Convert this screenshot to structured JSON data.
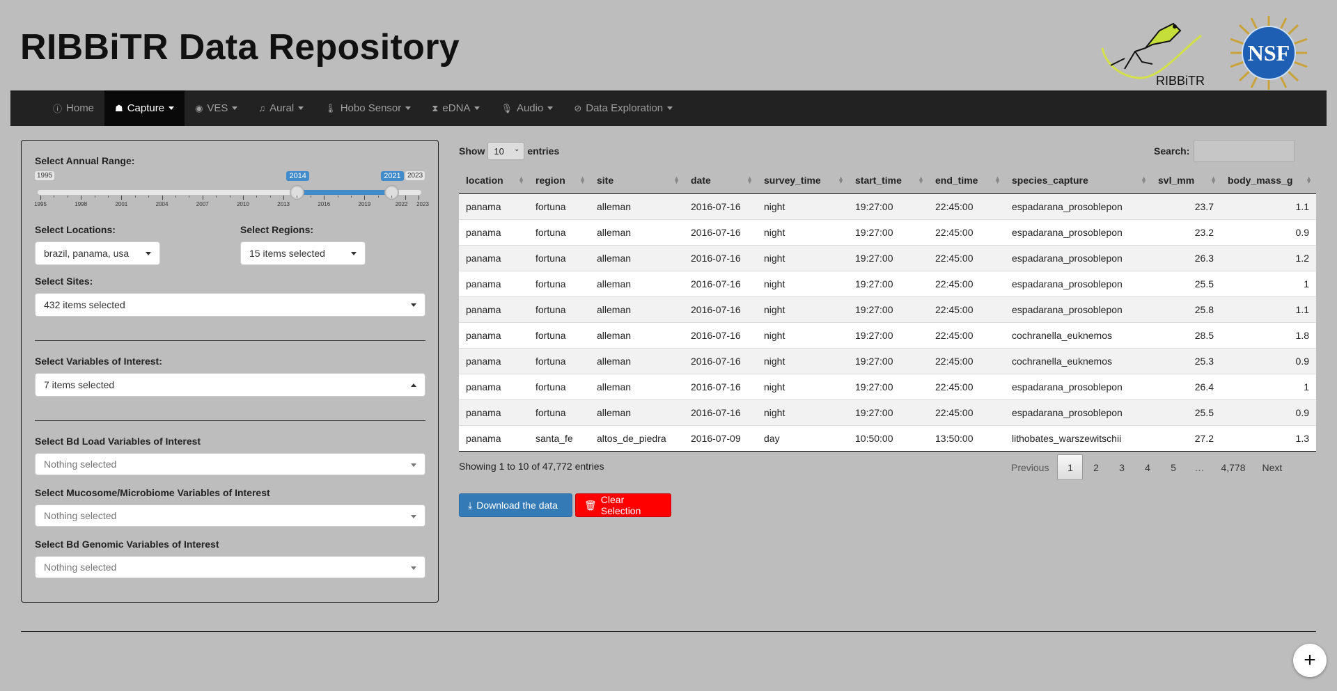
{
  "header": {
    "title": "RIBBiTR Data Repository",
    "ribbitr_logo_text": "RIBBiTR",
    "nsf_logo_text": "NSF"
  },
  "nav": {
    "items": [
      {
        "label": "Home",
        "icon": "info-circle-icon",
        "dropdown": false,
        "active": false
      },
      {
        "label": "Capture",
        "icon": "frog-icon",
        "dropdown": true,
        "active": true
      },
      {
        "label": "VES",
        "icon": "eye-icon",
        "dropdown": true,
        "active": false
      },
      {
        "label": "Aural",
        "icon": "music-icon",
        "dropdown": true,
        "active": false
      },
      {
        "label": "Hobo Sensor",
        "icon": "thermometer-icon",
        "dropdown": true,
        "active": false
      },
      {
        "label": "eDNA",
        "icon": "hourglass-icon",
        "dropdown": true,
        "active": false
      },
      {
        "label": "Audio",
        "icon": "microphone-icon",
        "dropdown": true,
        "active": false
      },
      {
        "label": "Data Exploration",
        "icon": "compass-icon",
        "dropdown": true,
        "active": false
      }
    ]
  },
  "sidebar": {
    "annual_range": {
      "label": "Select Annual Range:",
      "min": 1995,
      "max": 2023,
      "from": 2014,
      "to": 2021,
      "min_label": "1995",
      "max_label": "2023",
      "from_label": "2014",
      "to_label": "2021",
      "tick_labels": [
        "1995",
        "1998",
        "2001",
        "2004",
        "2007",
        "2010",
        "2013",
        "2016",
        "2019",
        "2022",
        "2023"
      ]
    },
    "locations": {
      "label": "Select Locations:",
      "value": "brazil, panama, usa"
    },
    "regions": {
      "label": "Select Regions:",
      "value": "15 items selected"
    },
    "sites": {
      "label": "Select Sites:",
      "value": "432 items selected"
    },
    "variables": {
      "label": "Select Variables of Interest:",
      "value": "7 items selected"
    },
    "bd_load": {
      "label": "Select Bd Load Variables of Interest",
      "value": "Nothing selected"
    },
    "mucosome": {
      "label": "Select Mucosome/Microbiome Variables of Interest",
      "value": "Nothing selected"
    },
    "bd_genomic": {
      "label": "Select Bd Genomic Variables of Interest",
      "value": "Nothing selected"
    }
  },
  "table": {
    "show_label": "Show",
    "entries_label": "entries",
    "page_length": "10",
    "search_label": "Search:",
    "columns": [
      "location",
      "region",
      "site",
      "date",
      "survey_time",
      "start_time",
      "end_time",
      "species_capture",
      "svl_mm",
      "body_mass_g"
    ],
    "rows": [
      [
        "panama",
        "fortuna",
        "alleman",
        "2016-07-16",
        "night",
        "19:27:00",
        "22:45:00",
        "espadarana_prosoblepon",
        "23.7",
        "1.1"
      ],
      [
        "panama",
        "fortuna",
        "alleman",
        "2016-07-16",
        "night",
        "19:27:00",
        "22:45:00",
        "espadarana_prosoblepon",
        "23.2",
        "0.9"
      ],
      [
        "panama",
        "fortuna",
        "alleman",
        "2016-07-16",
        "night",
        "19:27:00",
        "22:45:00",
        "espadarana_prosoblepon",
        "26.3",
        "1.2"
      ],
      [
        "panama",
        "fortuna",
        "alleman",
        "2016-07-16",
        "night",
        "19:27:00",
        "22:45:00",
        "espadarana_prosoblepon",
        "25.5",
        "1"
      ],
      [
        "panama",
        "fortuna",
        "alleman",
        "2016-07-16",
        "night",
        "19:27:00",
        "22:45:00",
        "espadarana_prosoblepon",
        "25.8",
        "1.1"
      ],
      [
        "panama",
        "fortuna",
        "alleman",
        "2016-07-16",
        "night",
        "19:27:00",
        "22:45:00",
        "cochranella_euknemos",
        "28.5",
        "1.8"
      ],
      [
        "panama",
        "fortuna",
        "alleman",
        "2016-07-16",
        "night",
        "19:27:00",
        "22:45:00",
        "cochranella_euknemos",
        "25.3",
        "0.9"
      ],
      [
        "panama",
        "fortuna",
        "alleman",
        "2016-07-16",
        "night",
        "19:27:00",
        "22:45:00",
        "espadarana_prosoblepon",
        "26.4",
        "1"
      ],
      [
        "panama",
        "fortuna",
        "alleman",
        "2016-07-16",
        "night",
        "19:27:00",
        "22:45:00",
        "espadarana_prosoblepon",
        "25.5",
        "0.9"
      ],
      [
        "panama",
        "santa_fe",
        "altos_de_piedra",
        "2016-07-09",
        "day",
        "10:50:00",
        "13:50:00",
        "lithobates_warszewitschii",
        "27.2",
        "1.3"
      ]
    ],
    "info": "Showing 1 to 10 of 47,772 entries",
    "pagination": [
      "Previous",
      "1",
      "2",
      "3",
      "4",
      "5",
      "…",
      "4,778",
      "Next"
    ],
    "current_page": "1"
  },
  "actions": {
    "download_label": "Download the data",
    "clear_label": "Clear Selection"
  },
  "colors": {
    "background": "#bdbdbd",
    "navbar": "#222222",
    "slider_accent": "#428bca",
    "download_button": "#337ab7",
    "clear_button": "#ff0000"
  },
  "fab": {
    "label": "+"
  }
}
